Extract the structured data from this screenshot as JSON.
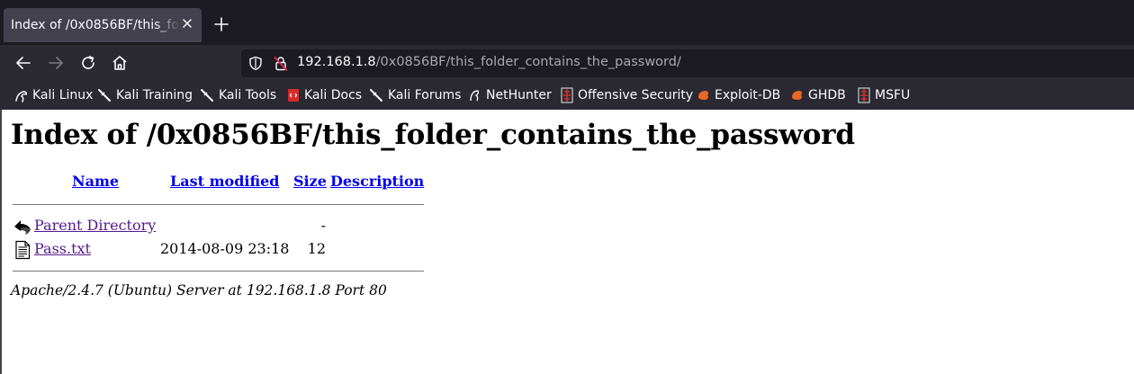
{
  "browser": {
    "tab": {
      "title": "Index of /0x0856BF/this_folder_contains_the_password"
    },
    "url": {
      "host": "192.168.1.8",
      "path": "/0x0856BF/this_folder_contains_the_password/"
    },
    "bookmarks": [
      {
        "label": "Kali Linux",
        "icon": "kali-dragon-icon"
      },
      {
        "label": "Kali Training",
        "icon": "kali-sword-icon"
      },
      {
        "label": "Kali Tools",
        "icon": "kali-sword-icon"
      },
      {
        "label": "Kali Docs",
        "icon": "kali-docs-icon"
      },
      {
        "label": "Kali Forums",
        "icon": "kali-sword-icon"
      },
      {
        "label": "NetHunter",
        "icon": "nethunter-icon"
      },
      {
        "label": "Offensive Security",
        "icon": "offsec-icon"
      },
      {
        "label": "Exploit-DB",
        "icon": "exploit-db-icon"
      },
      {
        "label": "GHDB",
        "icon": "ghdb-icon"
      },
      {
        "label": "MSFU",
        "icon": "msfu-icon"
      }
    ]
  },
  "page": {
    "title": "Index of /0x0856BF/this_folder_contains_the_password",
    "columns": {
      "name": "Name",
      "last_modified": "Last modified",
      "size": "Size",
      "description": "Description"
    },
    "rows": [
      {
        "name": "Parent Directory",
        "date": "",
        "size": "-",
        "icon": "back-arrow-icon"
      },
      {
        "name": "Pass.txt",
        "date": "2014-08-09 23:18",
        "size": "12",
        "icon": "text-file-icon"
      }
    ],
    "footer": "Apache/2.4.7 (Ubuntu) Server at 192.168.1.8 Port 80"
  },
  "colors": {
    "chrome_dark": "#1c1b22",
    "chrome": "#2b2a33",
    "tab_active": "#42414d",
    "link": "#0000ee",
    "visited": "#551a8b"
  }
}
